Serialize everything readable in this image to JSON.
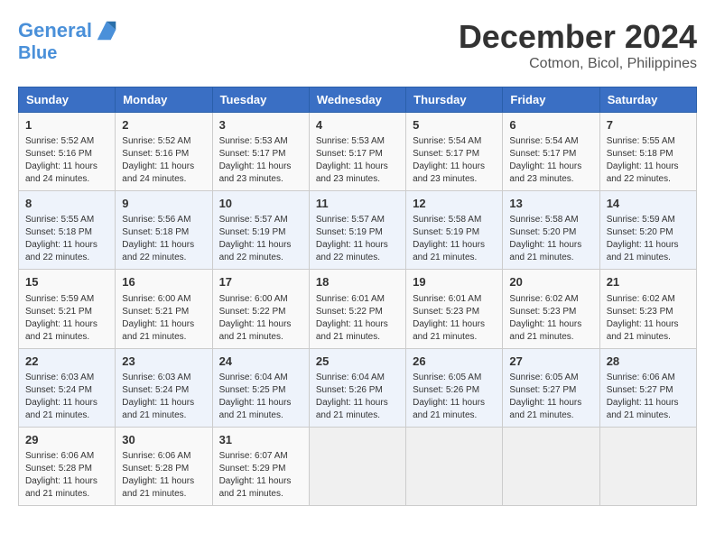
{
  "logo": {
    "line1": "General",
    "line2": "Blue"
  },
  "title": "December 2024",
  "subtitle": "Cotmon, Bicol, Philippines",
  "days_of_week": [
    "Sunday",
    "Monday",
    "Tuesday",
    "Wednesday",
    "Thursday",
    "Friday",
    "Saturday"
  ],
  "weeks": [
    [
      {
        "day": "1",
        "text": "Sunrise: 5:52 AM\nSunset: 5:16 PM\nDaylight: 11 hours and 24 minutes."
      },
      {
        "day": "2",
        "text": "Sunrise: 5:52 AM\nSunset: 5:16 PM\nDaylight: 11 hours and 24 minutes."
      },
      {
        "day": "3",
        "text": "Sunrise: 5:53 AM\nSunset: 5:17 PM\nDaylight: 11 hours and 23 minutes."
      },
      {
        "day": "4",
        "text": "Sunrise: 5:53 AM\nSunset: 5:17 PM\nDaylight: 11 hours and 23 minutes."
      },
      {
        "day": "5",
        "text": "Sunrise: 5:54 AM\nSunset: 5:17 PM\nDaylight: 11 hours and 23 minutes."
      },
      {
        "day": "6",
        "text": "Sunrise: 5:54 AM\nSunset: 5:17 PM\nDaylight: 11 hours and 23 minutes."
      },
      {
        "day": "7",
        "text": "Sunrise: 5:55 AM\nSunset: 5:18 PM\nDaylight: 11 hours and 22 minutes."
      }
    ],
    [
      {
        "day": "8",
        "text": "Sunrise: 5:55 AM\nSunset: 5:18 PM\nDaylight: 11 hours and 22 minutes."
      },
      {
        "day": "9",
        "text": "Sunrise: 5:56 AM\nSunset: 5:18 PM\nDaylight: 11 hours and 22 minutes."
      },
      {
        "day": "10",
        "text": "Sunrise: 5:57 AM\nSunset: 5:19 PM\nDaylight: 11 hours and 22 minutes."
      },
      {
        "day": "11",
        "text": "Sunrise: 5:57 AM\nSunset: 5:19 PM\nDaylight: 11 hours and 22 minutes."
      },
      {
        "day": "12",
        "text": "Sunrise: 5:58 AM\nSunset: 5:19 PM\nDaylight: 11 hours and 21 minutes."
      },
      {
        "day": "13",
        "text": "Sunrise: 5:58 AM\nSunset: 5:20 PM\nDaylight: 11 hours and 21 minutes."
      },
      {
        "day": "14",
        "text": "Sunrise: 5:59 AM\nSunset: 5:20 PM\nDaylight: 11 hours and 21 minutes."
      }
    ],
    [
      {
        "day": "15",
        "text": "Sunrise: 5:59 AM\nSunset: 5:21 PM\nDaylight: 11 hours and 21 minutes."
      },
      {
        "day": "16",
        "text": "Sunrise: 6:00 AM\nSunset: 5:21 PM\nDaylight: 11 hours and 21 minutes."
      },
      {
        "day": "17",
        "text": "Sunrise: 6:00 AM\nSunset: 5:22 PM\nDaylight: 11 hours and 21 minutes."
      },
      {
        "day": "18",
        "text": "Sunrise: 6:01 AM\nSunset: 5:22 PM\nDaylight: 11 hours and 21 minutes."
      },
      {
        "day": "19",
        "text": "Sunrise: 6:01 AM\nSunset: 5:23 PM\nDaylight: 11 hours and 21 minutes."
      },
      {
        "day": "20",
        "text": "Sunrise: 6:02 AM\nSunset: 5:23 PM\nDaylight: 11 hours and 21 minutes."
      },
      {
        "day": "21",
        "text": "Sunrise: 6:02 AM\nSunset: 5:23 PM\nDaylight: 11 hours and 21 minutes."
      }
    ],
    [
      {
        "day": "22",
        "text": "Sunrise: 6:03 AM\nSunset: 5:24 PM\nDaylight: 11 hours and 21 minutes."
      },
      {
        "day": "23",
        "text": "Sunrise: 6:03 AM\nSunset: 5:24 PM\nDaylight: 11 hours and 21 minutes."
      },
      {
        "day": "24",
        "text": "Sunrise: 6:04 AM\nSunset: 5:25 PM\nDaylight: 11 hours and 21 minutes."
      },
      {
        "day": "25",
        "text": "Sunrise: 6:04 AM\nSunset: 5:26 PM\nDaylight: 11 hours and 21 minutes."
      },
      {
        "day": "26",
        "text": "Sunrise: 6:05 AM\nSunset: 5:26 PM\nDaylight: 11 hours and 21 minutes."
      },
      {
        "day": "27",
        "text": "Sunrise: 6:05 AM\nSunset: 5:27 PM\nDaylight: 11 hours and 21 minutes."
      },
      {
        "day": "28",
        "text": "Sunrise: 6:06 AM\nSunset: 5:27 PM\nDaylight: 11 hours and 21 minutes."
      }
    ],
    [
      {
        "day": "29",
        "text": "Sunrise: 6:06 AM\nSunset: 5:28 PM\nDaylight: 11 hours and 21 minutes."
      },
      {
        "day": "30",
        "text": "Sunrise: 6:06 AM\nSunset: 5:28 PM\nDaylight: 11 hours and 21 minutes."
      },
      {
        "day": "31",
        "text": "Sunrise: 6:07 AM\nSunset: 5:29 PM\nDaylight: 11 hours and 21 minutes."
      },
      {
        "day": "",
        "text": ""
      },
      {
        "day": "",
        "text": ""
      },
      {
        "day": "",
        "text": ""
      },
      {
        "day": "",
        "text": ""
      }
    ]
  ]
}
